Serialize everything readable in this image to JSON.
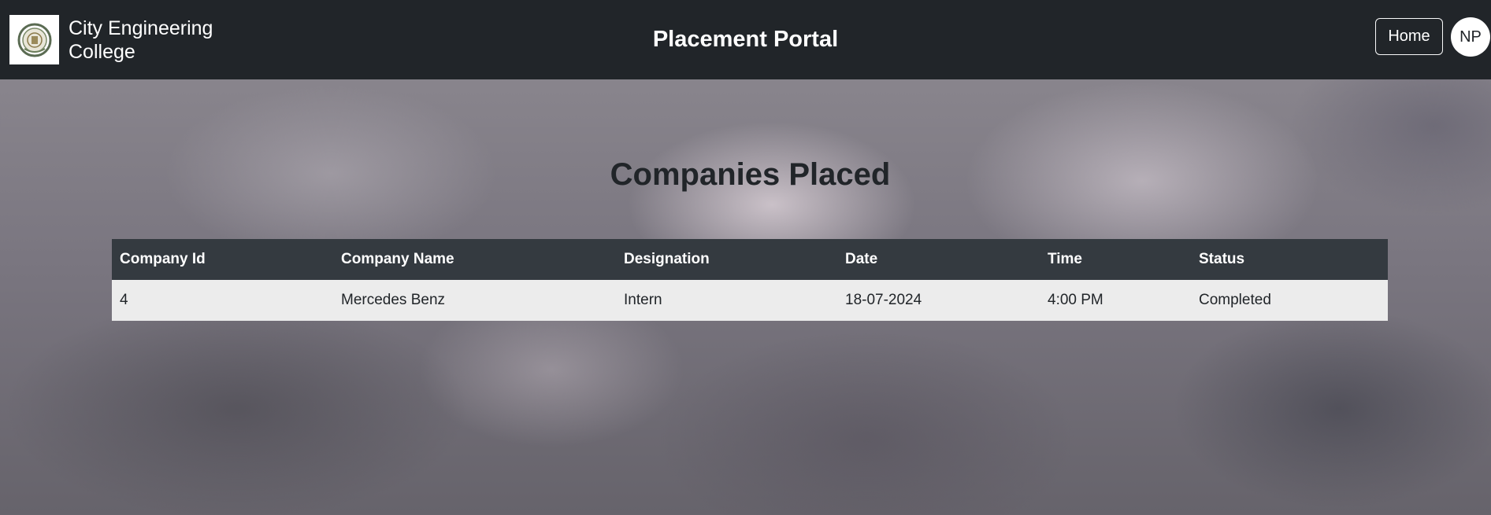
{
  "navbar": {
    "college_name": "City Engineering College",
    "portal_title": "Placement Portal",
    "home_label": "Home",
    "avatar_initials": "NP"
  },
  "main": {
    "heading": "Companies Placed",
    "table": {
      "columns": [
        "Company Id",
        "Company Name",
        "Designation",
        "Date",
        "Time",
        "Status"
      ],
      "rows": [
        [
          "4",
          "Mercedes Benz",
          "Intern",
          "18-07-2024",
          "4:00 PM",
          "Completed"
        ]
      ]
    }
  },
  "colors": {
    "navbar_bg": "#212529",
    "table_header_bg": "#343a40",
    "table_row_bg": "#ececec"
  },
  "icons": {
    "logo": "college-emblem-icon"
  }
}
